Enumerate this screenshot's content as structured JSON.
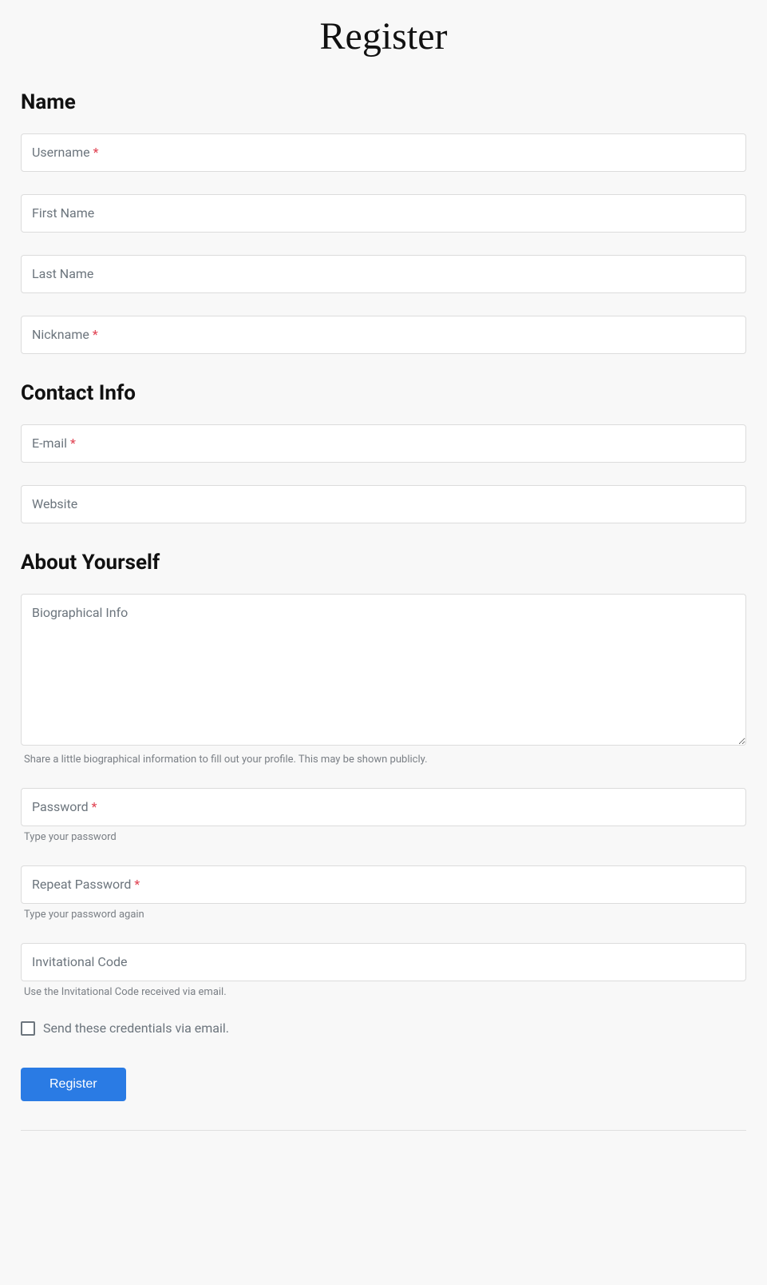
{
  "page": {
    "title": "Register"
  },
  "sections": {
    "name": {
      "heading": "Name"
    },
    "contact": {
      "heading": "Contact Info"
    },
    "about": {
      "heading": "About Yourself"
    }
  },
  "fields": {
    "username": {
      "label": "Username",
      "required": true
    },
    "first_name": {
      "label": "First Name",
      "required": false
    },
    "last_name": {
      "label": "Last Name",
      "required": false
    },
    "nickname": {
      "label": "Nickname",
      "required": true
    },
    "email": {
      "label": "E-mail",
      "required": true
    },
    "website": {
      "label": "Website",
      "required": false
    },
    "bio": {
      "label": "Biographical Info",
      "required": false,
      "hint": "Share a little biographical information to fill out your profile. This may be shown publicly."
    },
    "password": {
      "label": "Password",
      "required": true,
      "hint": "Type your password"
    },
    "repeat_password": {
      "label": "Repeat Password",
      "required": true,
      "hint": "Type your password again"
    },
    "invite": {
      "label": "Invitational Code",
      "required": false,
      "hint": "Use the Invitational Code received via email."
    }
  },
  "checkbox": {
    "send_credentials": {
      "label": "Send these credentials via email.",
      "checked": false
    }
  },
  "submit": {
    "label": "Register"
  },
  "required_marker": "*"
}
